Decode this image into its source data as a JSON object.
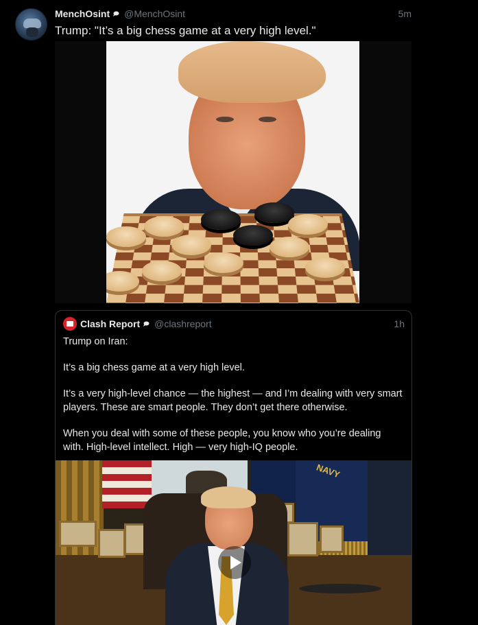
{
  "post": {
    "author_name": "MenchOsint",
    "author_handle": "@MenchOsint",
    "time": "5m",
    "text": "Trump: \"It’s a big chess game at a very high level.\"",
    "avatar_icon": "pilot-helmet-avatar",
    "media_icon": "checkers-board-image"
  },
  "quote": {
    "author_name": "Clash Report",
    "author_handle": "@clashreport",
    "time": "1h",
    "logo_color": "#d8232a",
    "paragraphs": [
      "Trump on Iran:",
      "It’s a big chess game at a very high level.",
      "It’s a very high-level chance — the highest — and I’m dealing with very smart players. These are smart people. They don’t get there otherwise.",
      "When you deal with some of these people, you know who you’re dealing with. High-level intellect. High — very high-IQ people."
    ],
    "video_navy_text": "NAVY",
    "play_icon": "play-icon"
  },
  "colors": {
    "background": "#000000",
    "text": "#e7e9ea",
    "muted": "#6e767d",
    "border": "#2f3336"
  }
}
